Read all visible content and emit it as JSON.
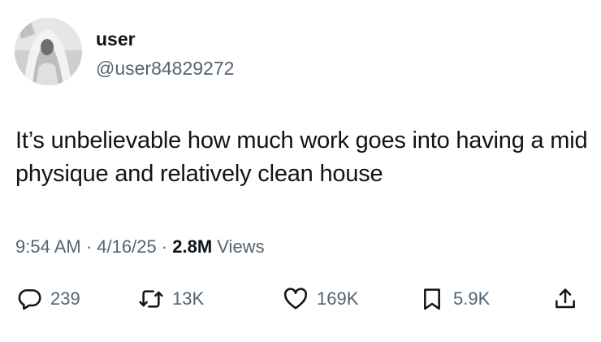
{
  "user": {
    "display_name": "user",
    "handle": "@user84829272"
  },
  "tweet": {
    "text": "It’s unbelievable how much work goes into having a mid physique and relatively clean house"
  },
  "meta": {
    "time": "9:54 AM",
    "separator": " · ",
    "date": "4/16/25",
    "views_count": "2.8M",
    "views_label": " Views"
  },
  "actions": {
    "replies": "239",
    "reposts": "13K",
    "likes": "169K",
    "bookmarks": "5.9K"
  },
  "icons": {
    "reply": "reply-bubble-icon",
    "repost": "repost-arrows-icon",
    "like": "heart-icon",
    "bookmark": "bookmark-icon",
    "share": "share-upload-icon"
  },
  "colors": {
    "text_primary": "#0f1419",
    "text_secondary": "#536471",
    "background": "#ffffff"
  }
}
